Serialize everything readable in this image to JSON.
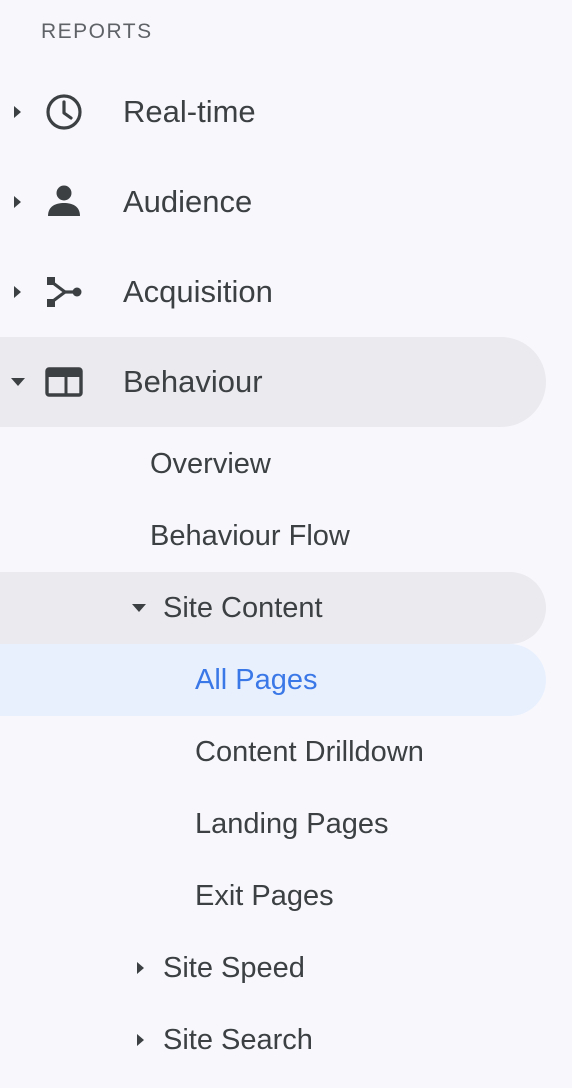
{
  "section": {
    "title": "REPORTS"
  },
  "nav": {
    "realtime": {
      "label": "Real-time",
      "icon": "clock-icon"
    },
    "audience": {
      "label": "Audience",
      "icon": "person-icon"
    },
    "acquisition": {
      "label": "Acquisition",
      "icon": "acquisition-icon"
    },
    "behaviour": {
      "label": "Behaviour",
      "icon": "behaviour-icon",
      "children": {
        "overview": {
          "label": "Overview"
        },
        "behaviour_flow": {
          "label": "Behaviour Flow"
        },
        "site_content": {
          "label": "Site Content",
          "children": {
            "all_pages": {
              "label": "All Pages"
            },
            "content_drilldown": {
              "label": "Content Drilldown"
            },
            "landing_pages": {
              "label": "Landing Pages"
            },
            "exit_pages": {
              "label": "Exit Pages"
            }
          }
        },
        "site_speed": {
          "label": "Site Speed"
        },
        "site_search": {
          "label": "Site Search"
        }
      }
    }
  },
  "colors": {
    "background": "#f8f8fc",
    "expanded_row": "#ebebef",
    "active_row": "#e8f0fe",
    "active_text": "#3b78e7",
    "text": "#3c4043"
  }
}
